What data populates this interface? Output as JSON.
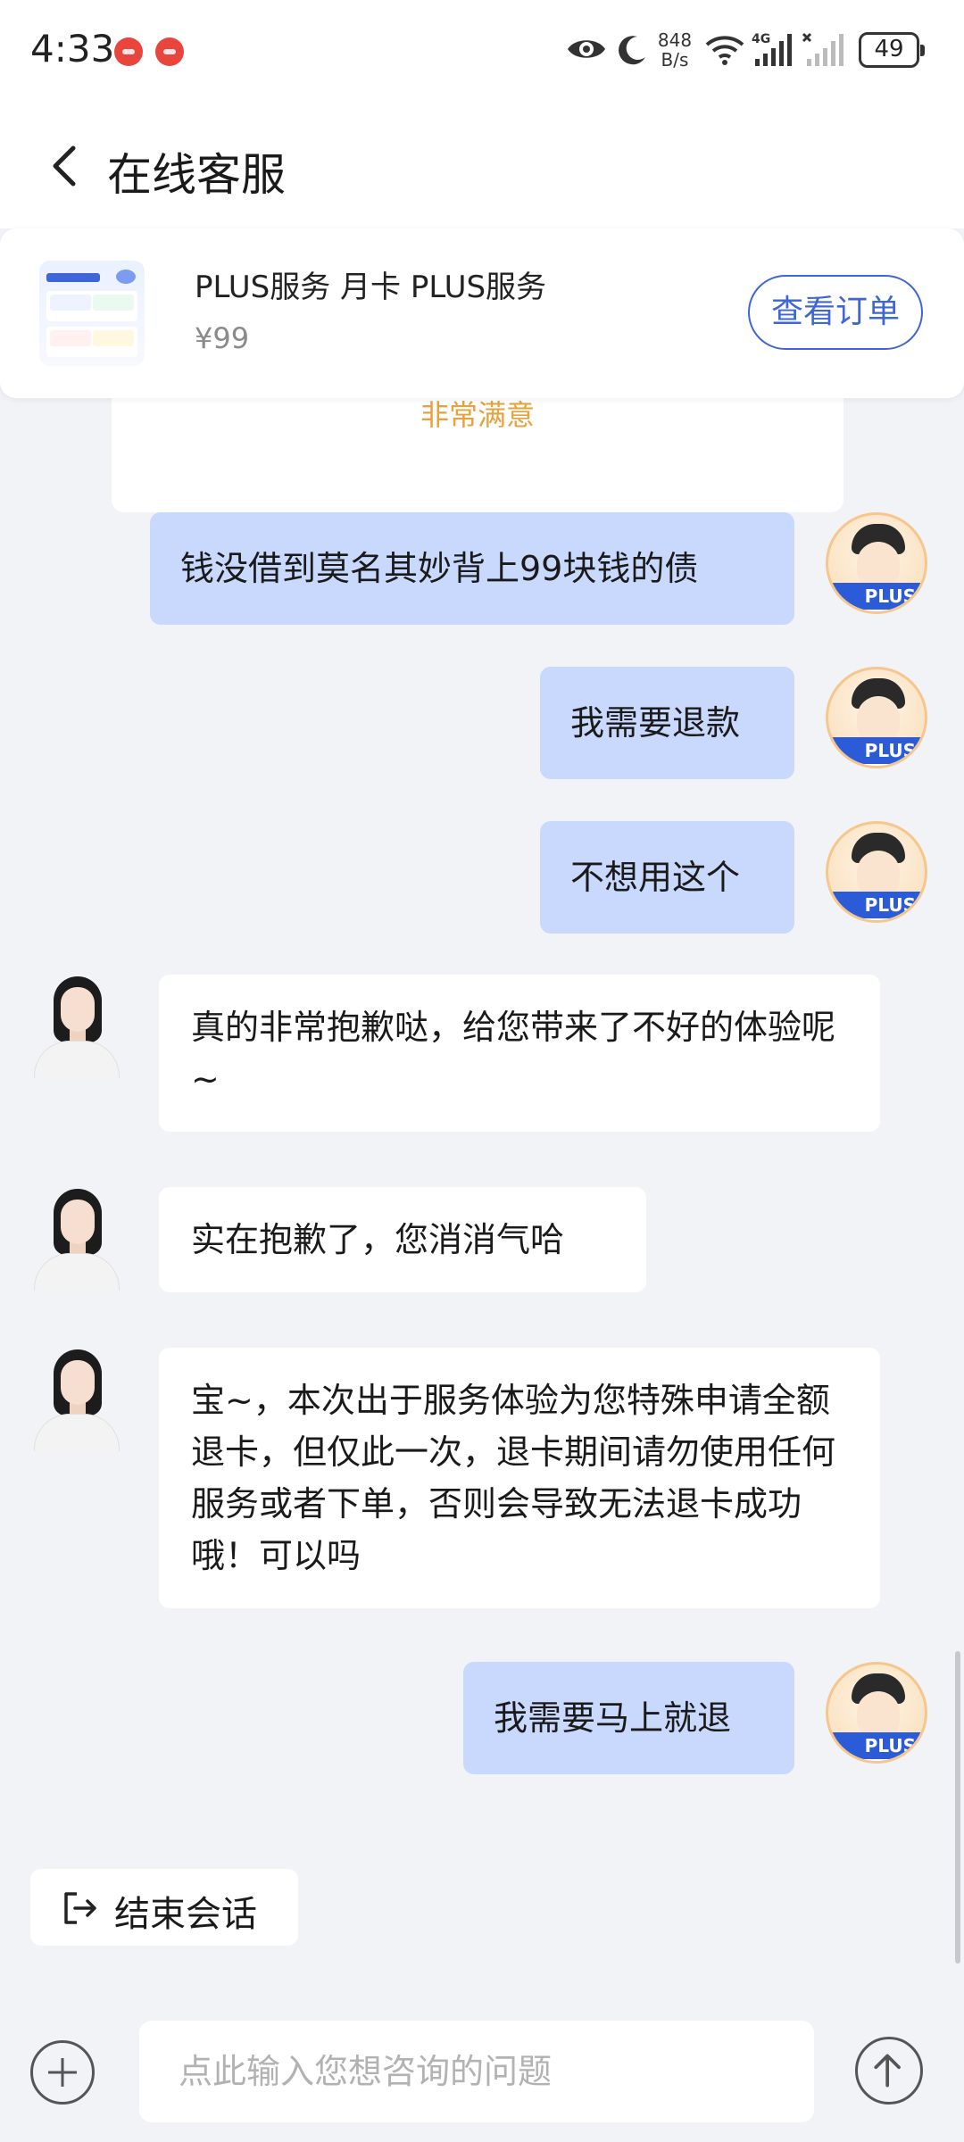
{
  "status_bar": {
    "time": "4:33",
    "net_speed_value": "848",
    "net_speed_unit": "B/s",
    "network_type": "4G",
    "battery": "49",
    "notification_color": "#e8453c"
  },
  "header": {
    "title": "在线客服",
    "back_icon": "chevron-left-icon"
  },
  "order_card": {
    "product_name": "PLUS服务 月卡 PLUS服务",
    "price": "¥99",
    "view_order_label": "查看订单"
  },
  "rating": {
    "label": "非常满意"
  },
  "messages": [
    {
      "sender": "user",
      "text": "钱没借到莫名其妙背上99块钱的债",
      "badge": "PLUS"
    },
    {
      "sender": "user",
      "text": "我需要退款",
      "badge": "PLUS"
    },
    {
      "sender": "user",
      "text": "不想用这个",
      "badge": "PLUS"
    },
    {
      "sender": "agent",
      "text": "真的非常抱歉哒，给您带来了不好的体验呢~"
    },
    {
      "sender": "agent",
      "text": "实在抱歉了，您消消气哈"
    },
    {
      "sender": "agent",
      "text": "宝~，本次出于服务体验为您特殊申请全额退卡，但仅此一次，退卡期间请勿使用任何服务或者下单，否则会导致无法退卡成功哦！可以吗"
    },
    {
      "sender": "user",
      "text": "我需要马上就退",
      "badge": "PLUS"
    }
  ],
  "end_chat": {
    "label": "结束会话",
    "icon": "exit-icon"
  },
  "input_bar": {
    "placeholder": "点此输入您想咨询的问题",
    "value": "",
    "add_icon": "plus-circle-icon",
    "send_icon": "arrow-up-circle-icon"
  },
  "colors": {
    "accent": "#3f66d6",
    "user_bubble": "#c9d8fd",
    "rating": "#e6a23c",
    "background": "#f2f3f7"
  }
}
